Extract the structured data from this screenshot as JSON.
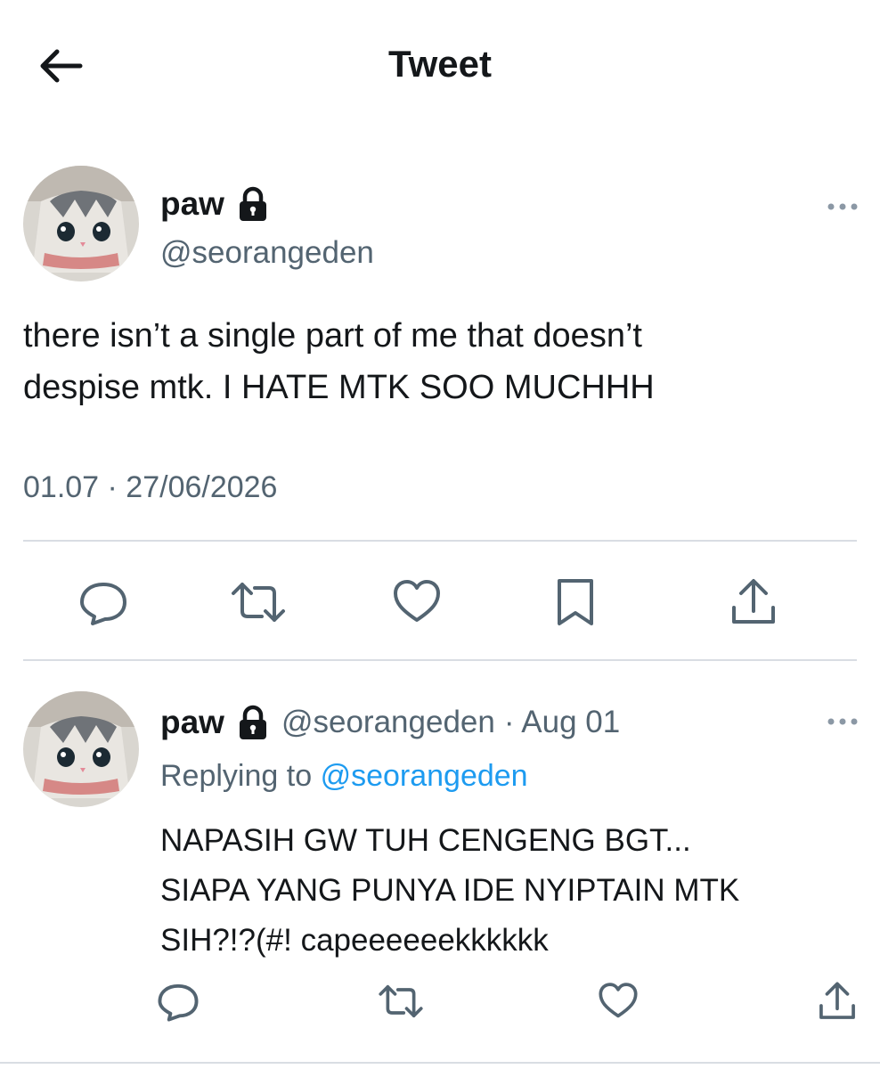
{
  "header": {
    "title": "Tweet"
  },
  "main_tweet": {
    "name": "paw",
    "handle": "@seorangeden",
    "text_line1": "there isn’t a single part of me that doesn’t",
    "text_line2": "despise mtk. I HATE MTK SOO MUCHHH",
    "timestamp": "01.07 · 27/06/2026",
    "locked": true
  },
  "reply": {
    "name": "paw",
    "handle": "@seorangeden",
    "date": "· Aug 01",
    "replying_to_label": "Replying to",
    "replying_to_handle": "@seorangeden",
    "text_line1": "NAPASIH GW TUH CENGENG BGT...",
    "text_line2": "SIAPA YANG PUNYA IDE NYIPTAIN MTK",
    "text_line3": "SIH?!?(#! capeeeeeekkkkkk",
    "locked": true
  },
  "icons": {
    "back": "arrow-left-icon",
    "lock": "lock-icon",
    "more": "more-horizontal-icon",
    "reply": "reply-bubble-icon",
    "retweet": "retweet-icon",
    "like": "heart-icon",
    "bookmark": "bookmark-icon",
    "share": "share-icon"
  },
  "colors": {
    "text": "#14171a",
    "secondary": "#536471",
    "link": "#1d9bf0",
    "divider": "#d9dde3"
  }
}
